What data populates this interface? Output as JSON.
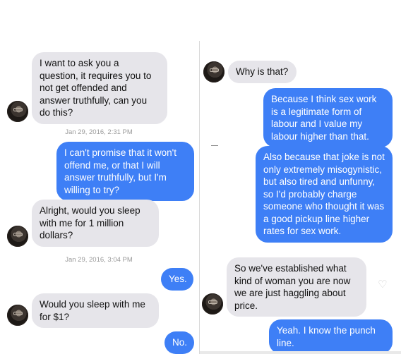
{
  "left": {
    "messages": [
      {
        "text": "I want to ask you a question, it requires you to not get offended and answer truthfully, can you do this?"
      },
      {
        "text": "I can't promise that it won't offend me, or that I will answer truthfully, but I'm willing to try?"
      },
      {
        "text": "Alright, would you sleep with me for 1 million dollars?"
      },
      {
        "text": "Yes."
      },
      {
        "text": "Would you sleep with me for $1?"
      },
      {
        "text": "No."
      }
    ],
    "timestamps": [
      "Jan 29, 2016, 2:31 PM",
      "Jan 29, 2016, 3:04 PM"
    ]
  },
  "right": {
    "messages": [
      {
        "text": "Why is that?"
      },
      {
        "text": "Because I think sex work is a legitimate form of labour and I value my labour higher than that."
      },
      {
        "text": "Also because that joke is not only extremely misogynistic, but also tired and unfunny, so I'd probably charge someone who thought it was a good pickup line higher rates for sex work."
      },
      {
        "text": "So we've established what kind of woman you are now we are just haggling about price."
      },
      {
        "text": "Yeah. I know the punch line."
      }
    ]
  },
  "colors": {
    "incoming": "#e6e5ea",
    "outgoing": "#3e7ff6",
    "timestamp": "#9a9a9a"
  },
  "icons": {
    "avatar": "avatar-photo",
    "like": "heart-icon"
  }
}
